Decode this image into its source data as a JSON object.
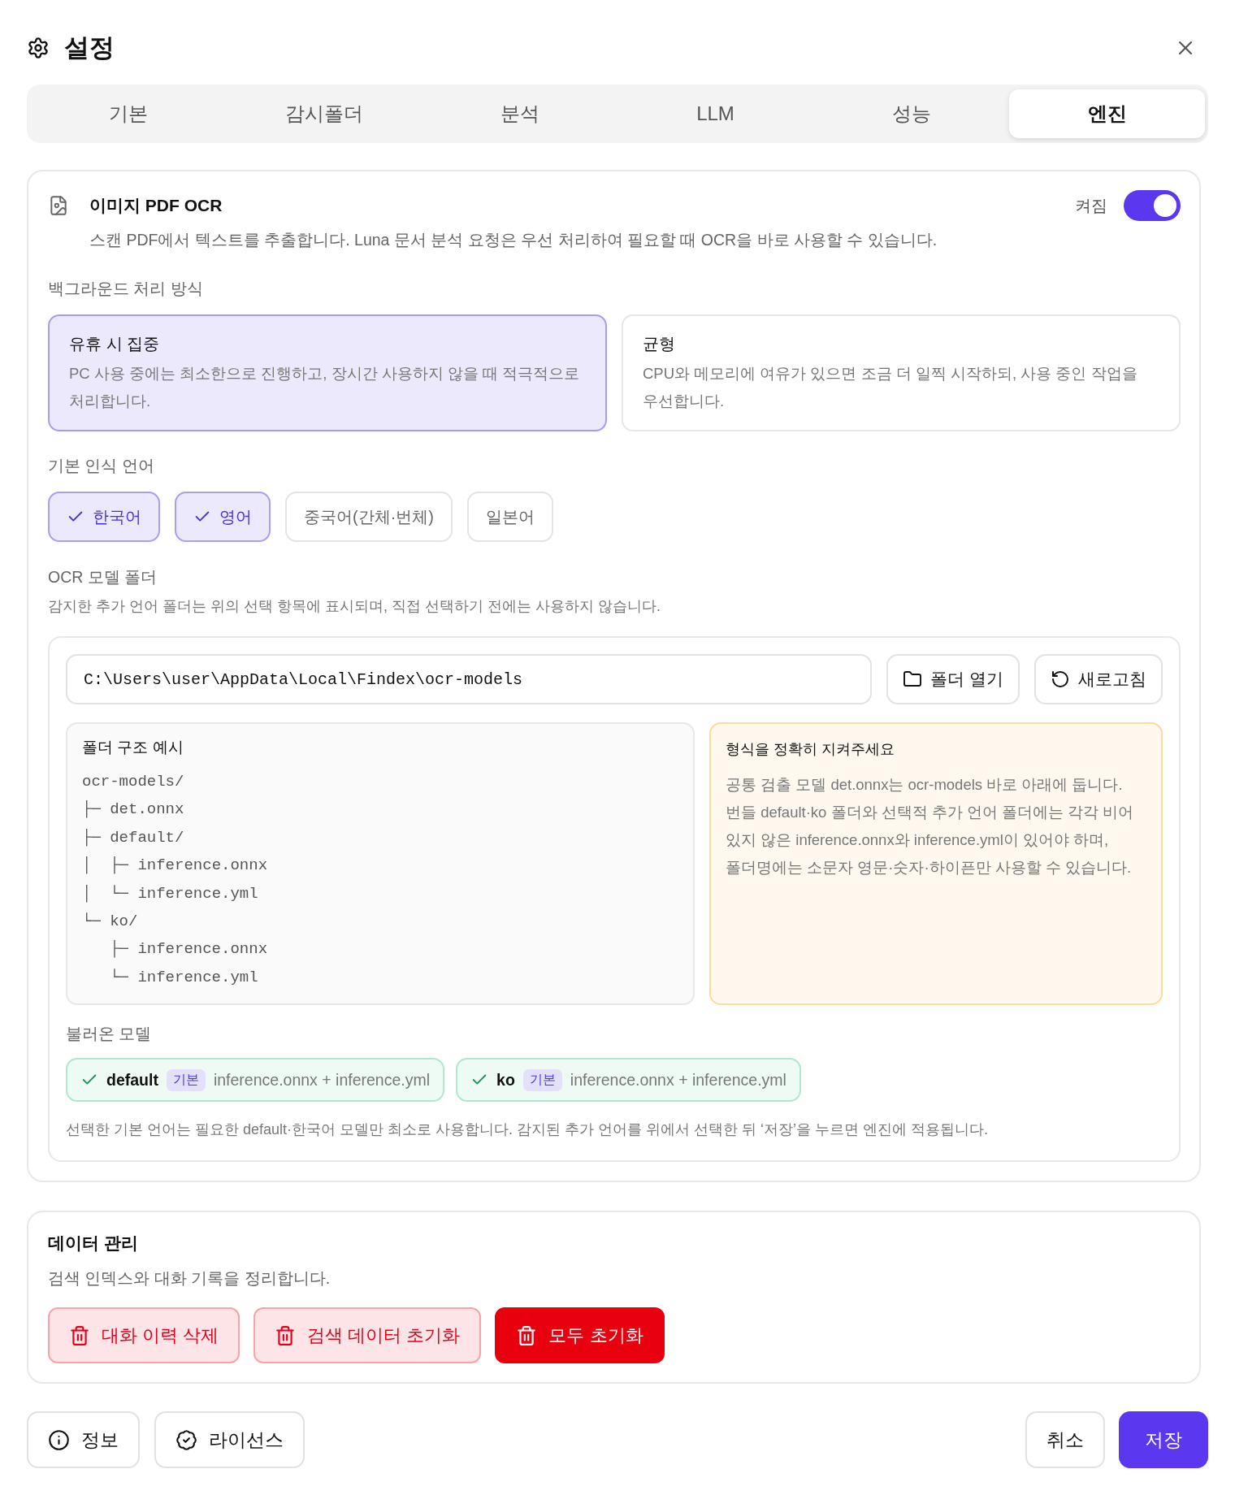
{
  "dialog": {
    "title": "설정"
  },
  "tabs": [
    {
      "label": "기본",
      "selected": false
    },
    {
      "label": "감시폴더",
      "selected": false
    },
    {
      "label": "분석",
      "selected": false
    },
    {
      "label": "LLM",
      "selected": false
    },
    {
      "label": "성능",
      "selected": false
    },
    {
      "label": "엔진",
      "selected": true
    }
  ],
  "ocr": {
    "title": "이미지 PDF OCR",
    "description": "스캔 PDF에서 텍스트를 추출합니다. Luna 문서 분석 요청은 우선 처리하여 필요할 때 OCR을 바로 사용할 수 있습니다.",
    "toggle": {
      "label": "켜짐",
      "on": true
    },
    "mode": {
      "label": "백그라운드 처리 방식",
      "options": [
        {
          "title": "유휴 시 집중",
          "description": "PC 사용 중에는 최소한으로 진행하고, 장시간 사용하지 않을 때 적극적으로 처리합니다.",
          "selected": true
        },
        {
          "title": "균형",
          "description": "CPU와 메모리에 여유가 있으면 조금 더 일찍 시작하되, 사용 중인 작업을 우선합니다.",
          "selected": false
        }
      ]
    },
    "languages": {
      "label": "기본 인식 언어",
      "options": [
        {
          "label": "한국어",
          "selected": true
        },
        {
          "label": "영어",
          "selected": true
        },
        {
          "label": "중국어(간체·번체)",
          "selected": false
        },
        {
          "label": "일본어",
          "selected": false
        }
      ]
    },
    "model_folder": {
      "label": "OCR 모델 폴더",
      "description": "감지한 추가 언어 폴더는 위의 선택 항목에 표시되며, 직접 선택하기 전에는 사용하지 않습니다.",
      "path": "C:\\Users\\user\\AppData\\Local\\Findex\\ocr-models",
      "buttons": [
        {
          "kind": "folder",
          "label": "폴더 열기"
        },
        {
          "kind": "refresh",
          "label": "새로고침"
        }
      ],
      "example": {
        "title": "폴더 구조 예시",
        "tree": {
          "name": "ocr-models/",
          "children": [
            {
              "branch": "├─",
              "name": "det.onnx"
            },
            {
              "branch": "├─",
              "name": "default/",
              "rail": "│",
              "children": [
                {
                  "branch": "├─",
                  "name": "inference.onnx"
                },
                {
                  "branch": "└─",
                  "name": "inference.yml"
                }
              ]
            },
            {
              "branch": "└─",
              "name": "ko/",
              "children": [
                {
                  "branch": "├─",
                  "name": "inference.onnx"
                },
                {
                  "branch": "└─",
                  "name": "inference.yml"
                }
              ]
            }
          ]
        }
      },
      "notice": {
        "title": "형식을 정확히 지켜주세요",
        "text": "공통 검출 모델 det.onnx는 ocr-models 바로 아래에 둡니다. 번들 default·ko 폴더와 선택적 추가 언어 폴더에는 각각 비어 있지 않은 inference.onnx와 inference.yml이 있어야 하며, 폴더명에는 소문자 영문·숫자·하이픈만 사용할 수 있습니다."
      },
      "loaded": {
        "label": "불러온 모델",
        "items": [
          {
            "name": "default",
            "badge": "기본",
            "files": "inference.onnx + inference.yml"
          },
          {
            "name": "ko",
            "badge": "기본",
            "files": "inference.onnx + inference.yml"
          }
        ]
      },
      "footnote": "선택한 기본 언어는 필요한 default·한국어 모델만 최소로 사용합니다. 감지된 추가 언어를 위에서 선택한 뒤 ‘저장’을 누르면 엔진에 적용됩니다."
    }
  },
  "data_management": {
    "title": "데이터 관리",
    "description": "검색 인덱스와 대화 기록을 정리합니다.",
    "buttons": [
      {
        "kind": "soft",
        "label": "대화 이력 삭제"
      },
      {
        "kind": "soft",
        "label": "검색 데이터 초기화"
      },
      {
        "kind": "solid",
        "label": "모두 초기화"
      }
    ]
  },
  "footer": {
    "left": [
      {
        "kind": "info",
        "label": "정보"
      },
      {
        "kind": "license",
        "label": "라이선스"
      }
    ],
    "right": [
      {
        "kind": "secondary",
        "label": "취소"
      },
      {
        "kind": "primary",
        "label": "저장"
      }
    ]
  }
}
